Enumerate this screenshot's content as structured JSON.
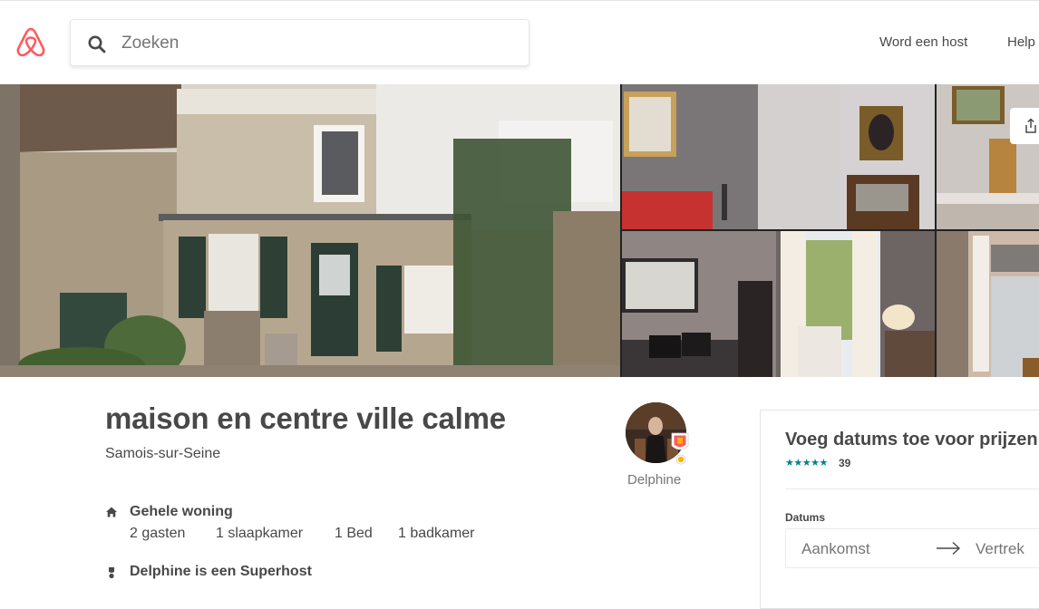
{
  "header": {
    "logo_name": "airbnb-logo",
    "search": {
      "placeholder": "Zoeken",
      "value": ""
    },
    "nav": {
      "host_label": "Word een host",
      "help_label": "Help"
    }
  },
  "listing": {
    "title": "maison en centre ville calme",
    "location": "Samois-sur-Seine",
    "host": {
      "name": "Delphine"
    },
    "features": {
      "type_label": "Gehele woning",
      "details": [
        "2 gasten",
        "1 slaapkamer",
        "1 Bed",
        "1 badkamer"
      ],
      "superhost_label": "Delphine is een Superhost"
    }
  },
  "booking": {
    "title": "Voeg datums toe voor prijzen",
    "stars": "★★★★★",
    "review_count": "39",
    "dates_label": "Datums",
    "checkin_label": "Aankomst",
    "checkout_label": "Vertrek"
  },
  "colors": {
    "brand": "#FF5A5F",
    "text": "#484848",
    "muted": "#767676",
    "stars": "#008489"
  },
  "icons": [
    "airbnb-logo",
    "search-icon",
    "share-icon",
    "home-icon",
    "superhost-icon",
    "arrow-right-icon",
    "superhost-badge-icon"
  ]
}
